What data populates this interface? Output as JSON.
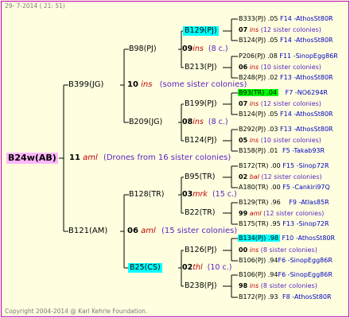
{
  "header": {
    "date": "29-  7-2014 ( 21: 51)"
  },
  "footer": {
    "copyright": "Copyright 2004-2014 @ Karl Kehrle Foundation."
  },
  "colors": {
    "highlight_cyan": "#00ffff",
    "highlight_green": "#00ff00",
    "root_bg": "#ffb6ff",
    "frame": "#c000c0",
    "ins": "#c00000",
    "note": "#5a22c0",
    "link": "#0000c0"
  },
  "root": {
    "id": "B24w(AB)"
  },
  "gen1": {
    "num": "11",
    "ins": "aml",
    "note": "(Drones from 16 sister colonies)"
  },
  "gen2": [
    {
      "id": "B399(JG)",
      "num": "10",
      "ins": "ins",
      "note": "(some sister colonies)"
    },
    {
      "id": "B121(AM)",
      "num": "06",
      "ins": "aml",
      "note": "(15 sister colonies)"
    }
  ],
  "gen3": [
    {
      "id": "B98(PJ)",
      "num": "09",
      "ins": "ins",
      "note": "(8 c.)"
    },
    {
      "id": "B209(JG)",
      "num": "08",
      "ins": "ins",
      "note": "(8 c.)"
    },
    {
      "id": "B128(TR)",
      "num": "03",
      "ins": "mrk",
      "note": "(15 c.)"
    },
    {
      "id": "B25(CS)",
      "num": "02",
      "ins": "thl",
      "note": "(10 c.)"
    }
  ],
  "gen4": [
    {
      "id": "B129(PJ)",
      "num": "07",
      "ins": "ins",
      "note": "(12 sister colonies)"
    },
    {
      "id": "B213(PJ)",
      "num": "06",
      "ins": "ins",
      "note": "(10 sister colonies)"
    },
    {
      "id": "B199(PJ)",
      "num": "07",
      "ins": "ins",
      "note": "(12 sister colonies)"
    },
    {
      "id": "B124(PJ)",
      "num": "05",
      "ins": "ins",
      "note": "(10 sister colonies)"
    },
    {
      "id": "B95(TR)",
      "num": "02",
      "ins": "bal",
      "note": "(12 sister colonies)"
    },
    {
      "id": "B22(TR)",
      "num": "99",
      "ins": "aml",
      "note": "(12 sister colonies)"
    },
    {
      "id": "B126(PJ)",
      "num": "00",
      "ins": "ins",
      "note": "(8 sister colonies)"
    },
    {
      "id": "B238(PJ)",
      "num": "98",
      "ins": "ins",
      "note": "(8 sister colonies)"
    }
  ],
  "gen5": [
    {
      "id": "B333(PJ)",
      "val": ".05",
      "link": "F14 -AthosSt80R"
    },
    {
      "id": "B124(PJ)",
      "val": ".05",
      "link": "F14 -AthosSt80R"
    },
    {
      "id": "P206(PJ)",
      "val": ".08",
      "link": "F11 -SinopEgg86R"
    },
    {
      "id": "B248(PJ)",
      "val": ".02",
      "link": "F13 -AthosSt80R"
    },
    {
      "id": "B93(TR)",
      "val": ".04",
      "link": "F7 -NO6294R"
    },
    {
      "id": "B124(PJ)",
      "val": ".05",
      "link": "F14 -AthosSt80R"
    },
    {
      "id": "B292(PJ)",
      "val": ".03",
      "link": "F13 -AthosSt80R"
    },
    {
      "id": "B158(PJ)",
      "val": ".01",
      "link": "F5 -Takab93R"
    },
    {
      "id": "B172(TR)",
      "val": ".00",
      "link": "F15 -Sinop72R"
    },
    {
      "id": "A180(TR)",
      "val": ".00",
      "link": "F5 -Cankiri97Q"
    },
    {
      "id": "B129(TR)",
      "val": ".96",
      "link": "F9 -Atlas85R"
    },
    {
      "id": "B175(TR)",
      "val": ".95",
      "link": "F13 -Sinop72R"
    },
    {
      "id": "B134(PJ)",
      "val": ".98",
      "link": "F10 -AthosSt80R"
    },
    {
      "id": "B106(PJ)",
      "val": ".94",
      "link": "F6 -SinopEgg86R"
    },
    {
      "id": "B106(PJ)",
      "val": ".94",
      "link": "F6 -SinopEgg86R"
    },
    {
      "id": "B172(PJ)",
      "val": ".93",
      "link": "F8 -AthosSt80R"
    }
  ]
}
